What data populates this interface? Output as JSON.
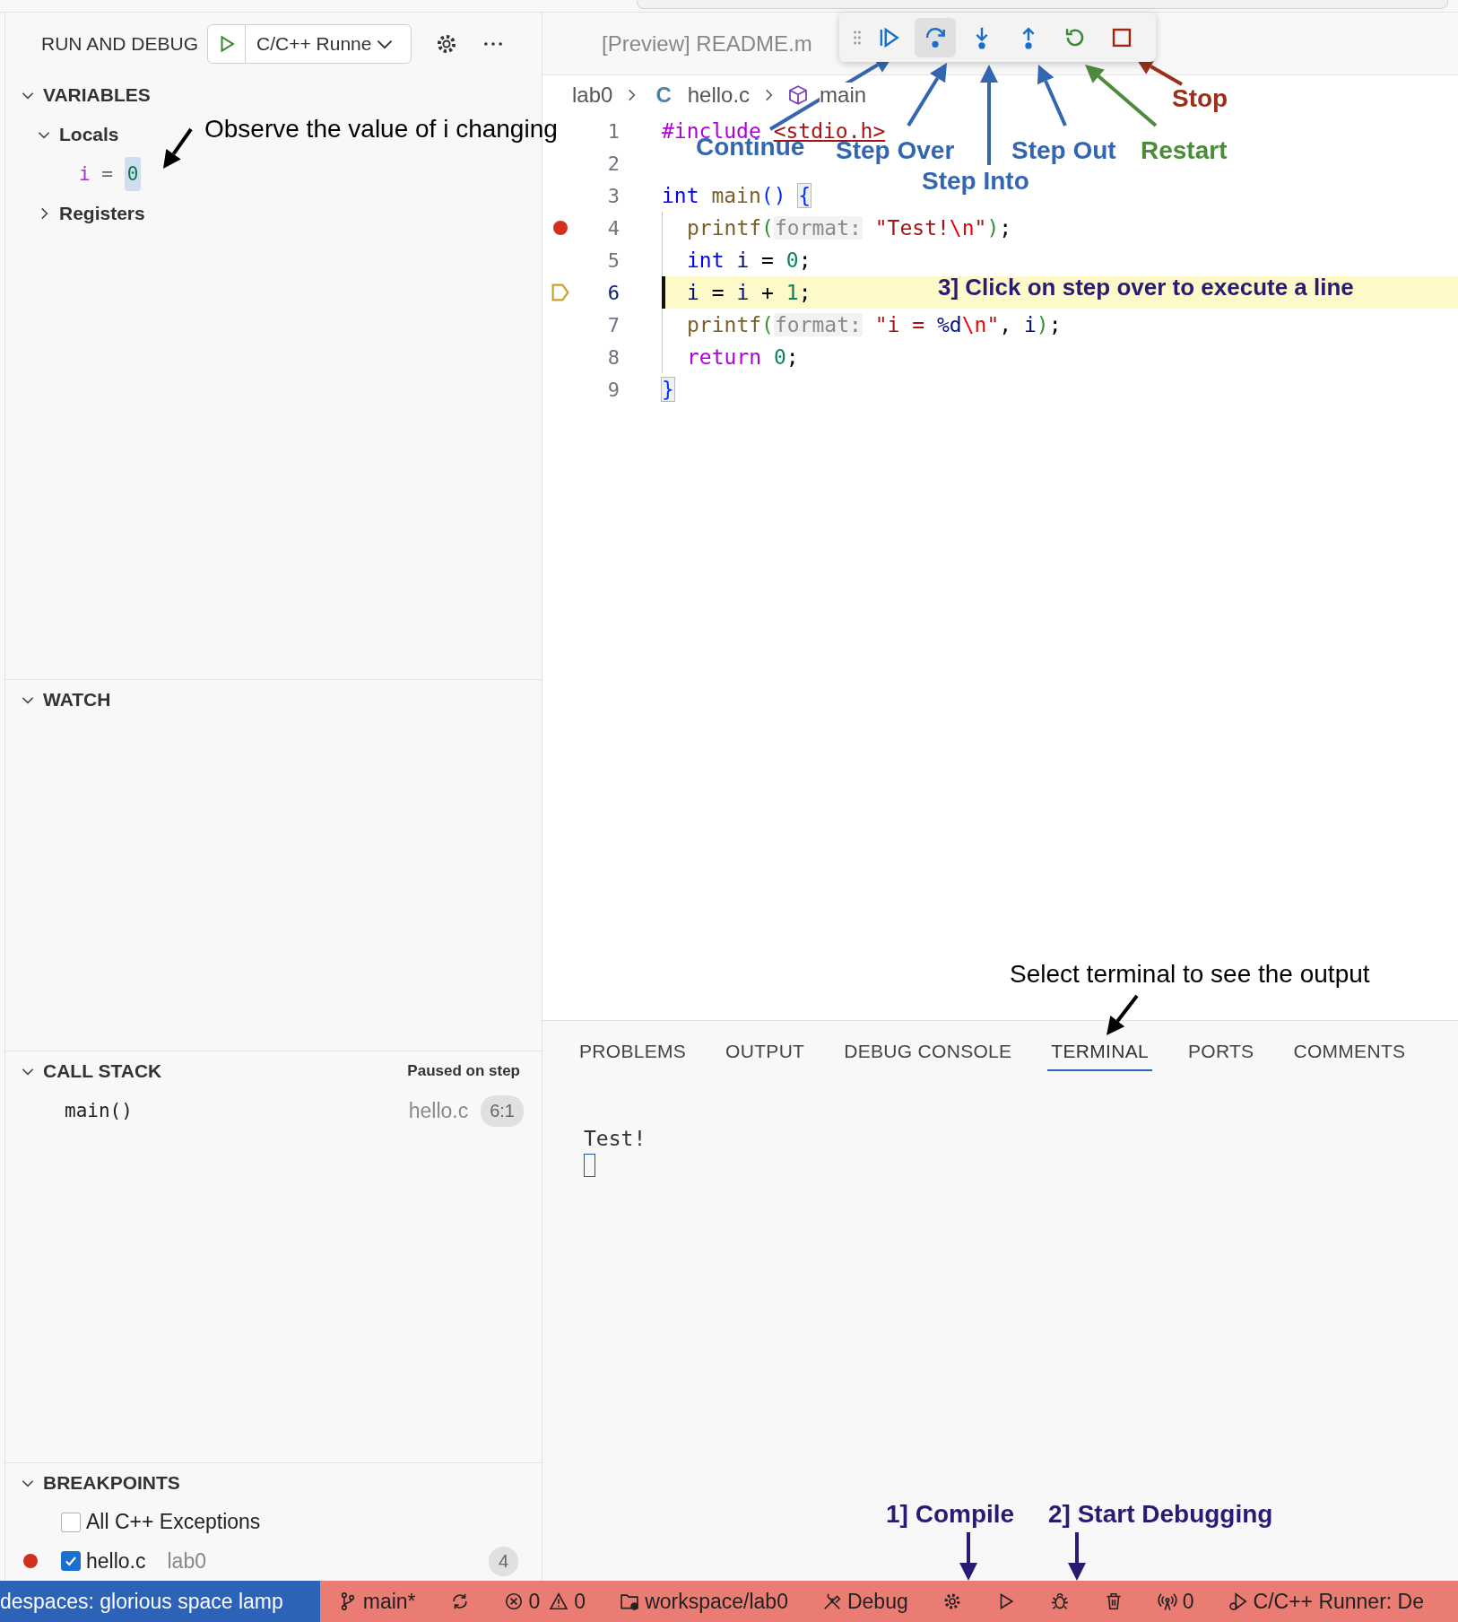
{
  "run_and_debug": {
    "title": "RUN AND DEBUG",
    "config": "C/C++ Runne"
  },
  "variables": {
    "title": "VARIABLES",
    "expanded": true,
    "scopes": [
      {
        "label": "Locals",
        "expanded": true,
        "children": [
          {
            "name": "i",
            "operator": "=",
            "value": "0",
            "changed": true
          }
        ]
      },
      {
        "label": "Registers",
        "expanded": false
      }
    ]
  },
  "watch": {
    "title": "WATCH",
    "expanded": true
  },
  "call_stack": {
    "title": "CALL STACK",
    "expanded": true,
    "status": "Paused on step",
    "frames": [
      {
        "name": "main()",
        "file": "hello.c",
        "position": "6:1"
      }
    ]
  },
  "breakpoints": {
    "title": "BREAKPOINTS",
    "expanded": true,
    "items": [
      {
        "label": "All C++ Exceptions",
        "checked": false,
        "dot": false
      },
      {
        "label": "hello.c",
        "detail": "lab0",
        "checked": true,
        "dot": true,
        "count": "4"
      }
    ]
  },
  "editor": {
    "tab": "[Preview] README.m",
    "breadcrumbs": [
      {
        "kind": "folder",
        "text": "lab0"
      },
      {
        "kind": "c-file",
        "icon": "C",
        "text": "hello.c"
      },
      {
        "kind": "function",
        "text": "main"
      }
    ],
    "lines": [
      {
        "number": "1",
        "breakpoint": false,
        "current": false,
        "guide": false,
        "tokens": [
          {
            "kind": "directive",
            "text": "#include "
          },
          {
            "kind": "include",
            "text": "<stdio.h>"
          }
        ]
      },
      {
        "number": "2",
        "breakpoint": false,
        "current": false,
        "guide": false
      },
      {
        "number": "3",
        "breakpoint": false,
        "current": false,
        "guide": false,
        "tokens": [
          {
            "kind": "keyword",
            "text": "int "
          },
          {
            "kind": "function",
            "text": "main"
          },
          {
            "kind": "bracket1",
            "text": "() "
          },
          {
            "kind": "bracket-match",
            "text": "{"
          }
        ]
      },
      {
        "number": "4",
        "breakpoint": true,
        "current": false,
        "guide": true,
        "tokens": [
          {
            "kind": "function",
            "text": "printf"
          },
          {
            "kind": "bracket2",
            "text": "("
          },
          {
            "kind": "hint",
            "text": "format:"
          },
          {
            "kind": "string",
            "text": " \"Test!"
          },
          {
            "kind": "escape",
            "text": "\\n"
          },
          {
            "kind": "string",
            "text": "\""
          },
          {
            "kind": "bracket2",
            "text": ")"
          },
          {
            "kind": "plain",
            "text": ";"
          }
        ]
      },
      {
        "number": "5",
        "breakpoint": false,
        "current": false,
        "guide": true,
        "tokens": [
          {
            "kind": "keyword",
            "text": "int "
          },
          {
            "kind": "variable",
            "text": "i"
          },
          {
            "kind": "plain",
            "text": " = "
          },
          {
            "kind": "number",
            "text": "0"
          },
          {
            "kind": "plain",
            "text": ";"
          }
        ]
      },
      {
        "number": "6",
        "breakpoint": false,
        "current": true,
        "guide": true,
        "tokens": [
          {
            "kind": "variable",
            "text": "i"
          },
          {
            "kind": "plain",
            "text": " = "
          },
          {
            "kind": "variable",
            "text": "i"
          },
          {
            "kind": "plain",
            "text": " + "
          },
          {
            "kind": "number",
            "text": "1"
          },
          {
            "kind": "plain",
            "text": ";"
          }
        ]
      },
      {
        "number": "7",
        "breakpoint": false,
        "current": false,
        "guide": true,
        "tokens": [
          {
            "kind": "function",
            "text": "printf"
          },
          {
            "kind": "bracket2",
            "text": "("
          },
          {
            "kind": "hint",
            "text": "format:"
          },
          {
            "kind": "string",
            "text": " \"i = "
          },
          {
            "kind": "variable",
            "text": "%d"
          },
          {
            "kind": "escape",
            "text": "\\n"
          },
          {
            "kind": "string",
            "text": "\""
          },
          {
            "kind": "plain",
            "text": ", "
          },
          {
            "kind": "variable",
            "text": "i"
          },
          {
            "kind": "bracket2",
            "text": ")"
          },
          {
            "kind": "plain",
            "text": ";"
          }
        ]
      },
      {
        "number": "8",
        "breakpoint": false,
        "current": false,
        "guide": true,
        "tokens": [
          {
            "kind": "control",
            "text": "return "
          },
          {
            "kind": "number",
            "text": "0"
          },
          {
            "kind": "plain",
            "text": ";"
          }
        ]
      },
      {
        "number": "9",
        "breakpoint": false,
        "current": false,
        "guide": false,
        "tokens": [
          {
            "kind": "bracket-match",
            "text": "}"
          }
        ]
      }
    ]
  },
  "debug_toolbar": {
    "buttons": [
      {
        "kind": "continue",
        "selected": false
      },
      {
        "kind": "step-over",
        "selected": true
      },
      {
        "kind": "step-into",
        "selected": false
      },
      {
        "kind": "step-out",
        "selected": false
      },
      {
        "kind": "restart",
        "selected": false
      },
      {
        "kind": "stop",
        "selected": false
      }
    ]
  },
  "panel": {
    "tabs": [
      {
        "label": "PROBLEMS",
        "selected": false
      },
      {
        "label": "OUTPUT",
        "selected": false
      },
      {
        "label": "DEBUG CONSOLE",
        "selected": false
      },
      {
        "label": "TERMINAL",
        "selected": true
      },
      {
        "label": "PORTS",
        "selected": false
      },
      {
        "label": "COMMENTS",
        "selected": false
      }
    ],
    "terminal_lines": [
      "Test!"
    ]
  },
  "status_bar": {
    "remote": "despaces: glorious space lamp",
    "items": [
      {
        "kind": "branch",
        "text": "main*"
      },
      {
        "kind": "sync"
      },
      {
        "kind": "errors",
        "text": "0"
      },
      {
        "kind": "warnings",
        "text": "0"
      },
      {
        "kind": "folder",
        "text": "workspace/lab0"
      },
      {
        "kind": "tools",
        "text": "Debug"
      },
      {
        "kind": "gear"
      },
      {
        "kind": "play"
      },
      {
        "kind": "bug"
      },
      {
        "kind": "trash"
      },
      {
        "kind": "broadcast",
        "text": "0"
      },
      {
        "kind": "runner",
        "text": "C/C++ Runner: De"
      }
    ]
  },
  "annotations": [
    {
      "kind": "note",
      "text": "Observe the value of i changing",
      "color": "#000000"
    },
    {
      "kind": "label",
      "text": "Stop",
      "color": "#9a2f1c"
    },
    {
      "kind": "label",
      "text": "Continue",
      "color": "#3466b0"
    },
    {
      "kind": "label",
      "text": "Step Over",
      "color": "#3466b0"
    },
    {
      "kind": "label",
      "text": "Step Out",
      "color": "#3466b0"
    },
    {
      "kind": "label",
      "text": "Restart",
      "color": "#4b8b3b"
    },
    {
      "kind": "label",
      "text": "Step Into",
      "color": "#3466b0"
    },
    {
      "kind": "label",
      "text": "3] Click on step over to execute a line",
      "color": "#2b1a73"
    },
    {
      "kind": "note",
      "text": "Select terminal to see the output",
      "color": "#000000"
    },
    {
      "kind": "label",
      "text": "1] Compile",
      "color": "#2b1a73"
    },
    {
      "kind": "label",
      "text": "2] Start Debugging",
      "color": "#2b1a73"
    }
  ]
}
